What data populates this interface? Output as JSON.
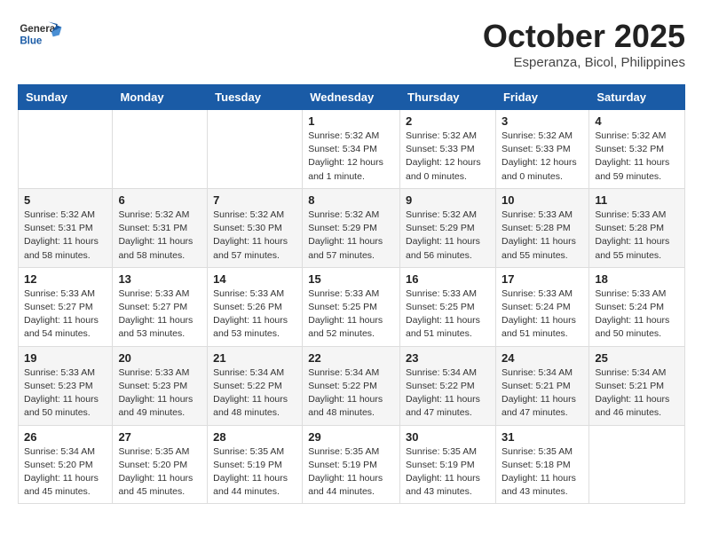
{
  "header": {
    "logo_general": "General",
    "logo_blue": "Blue",
    "month": "October 2025",
    "location": "Esperanza, Bicol, Philippines"
  },
  "weekdays": [
    "Sunday",
    "Monday",
    "Tuesday",
    "Wednesday",
    "Thursday",
    "Friday",
    "Saturday"
  ],
  "weeks": [
    [
      {
        "day": "",
        "info": ""
      },
      {
        "day": "",
        "info": ""
      },
      {
        "day": "",
        "info": ""
      },
      {
        "day": "1",
        "info": "Sunrise: 5:32 AM\nSunset: 5:34 PM\nDaylight: 12 hours\nand 1 minute."
      },
      {
        "day": "2",
        "info": "Sunrise: 5:32 AM\nSunset: 5:33 PM\nDaylight: 12 hours\nand 0 minutes."
      },
      {
        "day": "3",
        "info": "Sunrise: 5:32 AM\nSunset: 5:33 PM\nDaylight: 12 hours\nand 0 minutes."
      },
      {
        "day": "4",
        "info": "Sunrise: 5:32 AM\nSunset: 5:32 PM\nDaylight: 11 hours\nand 59 minutes."
      }
    ],
    [
      {
        "day": "5",
        "info": "Sunrise: 5:32 AM\nSunset: 5:31 PM\nDaylight: 11 hours\nand 58 minutes."
      },
      {
        "day": "6",
        "info": "Sunrise: 5:32 AM\nSunset: 5:31 PM\nDaylight: 11 hours\nand 58 minutes."
      },
      {
        "day": "7",
        "info": "Sunrise: 5:32 AM\nSunset: 5:30 PM\nDaylight: 11 hours\nand 57 minutes."
      },
      {
        "day": "8",
        "info": "Sunrise: 5:32 AM\nSunset: 5:29 PM\nDaylight: 11 hours\nand 57 minutes."
      },
      {
        "day": "9",
        "info": "Sunrise: 5:32 AM\nSunset: 5:29 PM\nDaylight: 11 hours\nand 56 minutes."
      },
      {
        "day": "10",
        "info": "Sunrise: 5:33 AM\nSunset: 5:28 PM\nDaylight: 11 hours\nand 55 minutes."
      },
      {
        "day": "11",
        "info": "Sunrise: 5:33 AM\nSunset: 5:28 PM\nDaylight: 11 hours\nand 55 minutes."
      }
    ],
    [
      {
        "day": "12",
        "info": "Sunrise: 5:33 AM\nSunset: 5:27 PM\nDaylight: 11 hours\nand 54 minutes."
      },
      {
        "day": "13",
        "info": "Sunrise: 5:33 AM\nSunset: 5:27 PM\nDaylight: 11 hours\nand 53 minutes."
      },
      {
        "day": "14",
        "info": "Sunrise: 5:33 AM\nSunset: 5:26 PM\nDaylight: 11 hours\nand 53 minutes."
      },
      {
        "day": "15",
        "info": "Sunrise: 5:33 AM\nSunset: 5:25 PM\nDaylight: 11 hours\nand 52 minutes."
      },
      {
        "day": "16",
        "info": "Sunrise: 5:33 AM\nSunset: 5:25 PM\nDaylight: 11 hours\nand 51 minutes."
      },
      {
        "day": "17",
        "info": "Sunrise: 5:33 AM\nSunset: 5:24 PM\nDaylight: 11 hours\nand 51 minutes."
      },
      {
        "day": "18",
        "info": "Sunrise: 5:33 AM\nSunset: 5:24 PM\nDaylight: 11 hours\nand 50 minutes."
      }
    ],
    [
      {
        "day": "19",
        "info": "Sunrise: 5:33 AM\nSunset: 5:23 PM\nDaylight: 11 hours\nand 50 minutes."
      },
      {
        "day": "20",
        "info": "Sunrise: 5:33 AM\nSunset: 5:23 PM\nDaylight: 11 hours\nand 49 minutes."
      },
      {
        "day": "21",
        "info": "Sunrise: 5:34 AM\nSunset: 5:22 PM\nDaylight: 11 hours\nand 48 minutes."
      },
      {
        "day": "22",
        "info": "Sunrise: 5:34 AM\nSunset: 5:22 PM\nDaylight: 11 hours\nand 48 minutes."
      },
      {
        "day": "23",
        "info": "Sunrise: 5:34 AM\nSunset: 5:22 PM\nDaylight: 11 hours\nand 47 minutes."
      },
      {
        "day": "24",
        "info": "Sunrise: 5:34 AM\nSunset: 5:21 PM\nDaylight: 11 hours\nand 47 minutes."
      },
      {
        "day": "25",
        "info": "Sunrise: 5:34 AM\nSunset: 5:21 PM\nDaylight: 11 hours\nand 46 minutes."
      }
    ],
    [
      {
        "day": "26",
        "info": "Sunrise: 5:34 AM\nSunset: 5:20 PM\nDaylight: 11 hours\nand 45 minutes."
      },
      {
        "day": "27",
        "info": "Sunrise: 5:35 AM\nSunset: 5:20 PM\nDaylight: 11 hours\nand 45 minutes."
      },
      {
        "day": "28",
        "info": "Sunrise: 5:35 AM\nSunset: 5:19 PM\nDaylight: 11 hours\nand 44 minutes."
      },
      {
        "day": "29",
        "info": "Sunrise: 5:35 AM\nSunset: 5:19 PM\nDaylight: 11 hours\nand 44 minutes."
      },
      {
        "day": "30",
        "info": "Sunrise: 5:35 AM\nSunset: 5:19 PM\nDaylight: 11 hours\nand 43 minutes."
      },
      {
        "day": "31",
        "info": "Sunrise: 5:35 AM\nSunset: 5:18 PM\nDaylight: 11 hours\nand 43 minutes."
      },
      {
        "day": "",
        "info": ""
      }
    ]
  ]
}
